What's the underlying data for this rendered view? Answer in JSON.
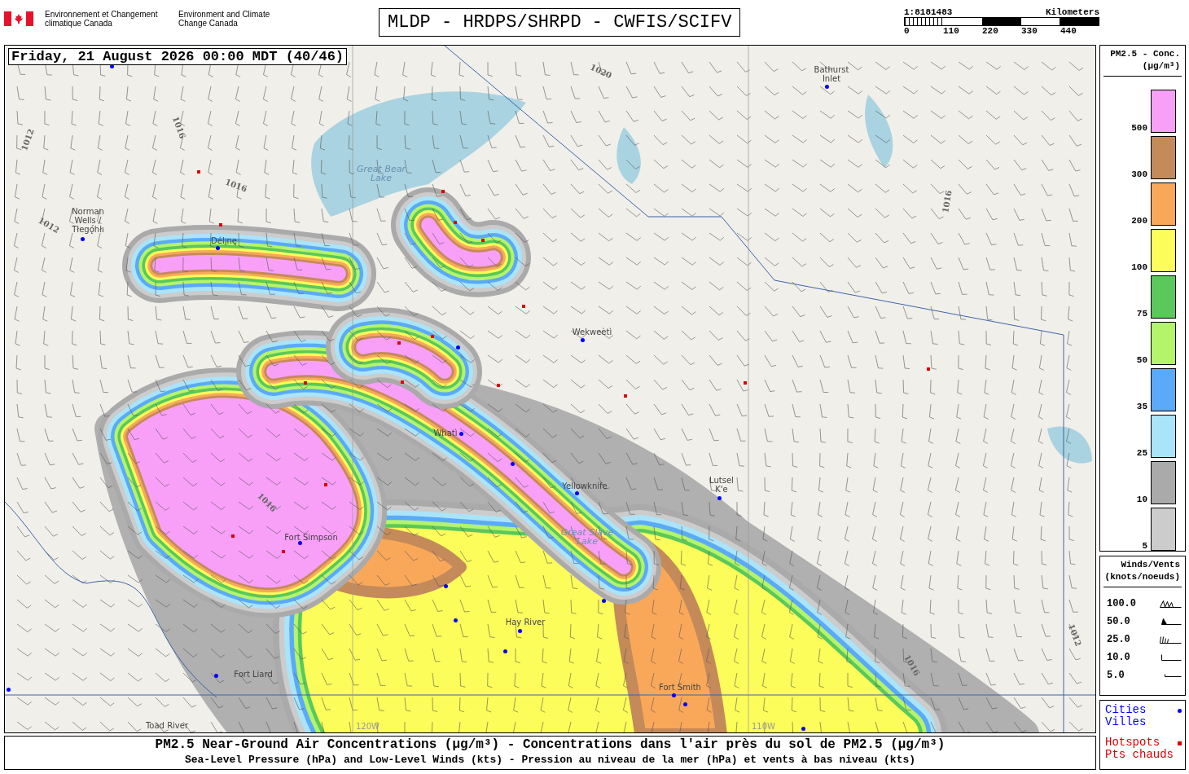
{
  "header": {
    "agency_fr": "Environnement et Changement climatique Canada",
    "agency_en": "Environment and Climate Change Canada",
    "title": "MLDP - HRDPS/SHRPD - CWFIS/SCIFV",
    "scale": {
      "ratio": "1:8181483",
      "unit": "Kilometers",
      "ticks": [
        "0",
        "110",
        "220",
        "330",
        "440"
      ]
    }
  },
  "map": {
    "timestamp": "Friday, 21 August 2026 00:00 MDT (40/46)",
    "places": [
      {
        "kind": "city",
        "name": "Bathurst Inlet"
      },
      {
        "kind": "lake",
        "name": "Great Bear Lake"
      },
      {
        "kind": "city",
        "name": "Norman Wells / Tłegǫ́hłı"
      },
      {
        "kind": "city",
        "name": "Délı̨nę"
      },
      {
        "kind": "city",
        "name": "Wekweètì"
      },
      {
        "kind": "city",
        "name": "Whatì"
      },
      {
        "kind": "city",
        "name": "Lutsel K'e"
      },
      {
        "kind": "city",
        "name": "Yellowknife"
      },
      {
        "kind": "city",
        "name": "Fort Simpson"
      },
      {
        "kind": "lake",
        "name": "Great Slave Lake"
      },
      {
        "kind": "city",
        "name": "Hay River"
      },
      {
        "kind": "city",
        "name": "Fort Smith"
      },
      {
        "kind": "city",
        "name": "Fort Liard"
      },
      {
        "kind": "city",
        "name": "Toad River"
      }
    ],
    "isobars": [
      "1012",
      "1016",
      "1016",
      "1020",
      "1016",
      "1012",
      "1016",
      "1016",
      "1012"
    ],
    "meridians": [
      "120W",
      "110W"
    ]
  },
  "legend": {
    "title": "PM2.5 - Conc.",
    "units": "(µg/m³)",
    "bins": [
      {
        "color": "#f8a0f8",
        "label": "500"
      },
      {
        "color": "#c48a5a",
        "label": "300"
      },
      {
        "color": "#f9a85a",
        "label": "200"
      },
      {
        "color": "#fcfc5a",
        "label": "100"
      },
      {
        "color": "#5ac85a",
        "label": "75"
      },
      {
        "color": "#b4f46a",
        "label": "50"
      },
      {
        "color": "#5aaaf9",
        "label": "35"
      },
      {
        "color": "#aae4f9",
        "label": "25"
      },
      {
        "color": "#aaaaaa",
        "label": "10"
      },
      {
        "color": "#cccccc",
        "label": "5"
      }
    ],
    "winds": {
      "title": "Winds/Vents",
      "units": "(knots/noeuds)",
      "speeds": [
        "100.0",
        "50.0",
        "25.0",
        "10.0",
        "5.0"
      ]
    },
    "key": [
      {
        "kind": "cities",
        "label_en": "Cities",
        "label_fr": "Villes",
        "color": "#0000ff"
      },
      {
        "kind": "hotspots",
        "label_en": "Hotspots",
        "label_fr": "Pts chauds",
        "color": "#dd0000"
      }
    ]
  },
  "caption": {
    "line1": "PM2.5 Near-Ground Air Concentrations (µg/m³) - Concentrations dans l'air près du sol de PM2.5 (µg/m³)",
    "line2": "Sea-Level Pressure (hPa) and Low-Level Winds (kts) - Pression au niveau de la mer (hPa) et vents à bas niveau (kts)"
  }
}
